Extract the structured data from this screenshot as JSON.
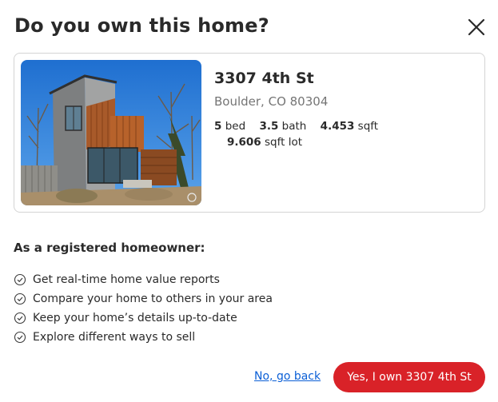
{
  "dialog": {
    "title": "Do you own this home?",
    "close_icon": "close-icon"
  },
  "property": {
    "address": "3307 4th St",
    "city_state_zip": "Boulder, CO 80304",
    "beds": "5",
    "beds_label": "bed",
    "baths": "3.5",
    "baths_label": "bath",
    "sqft": "4.453",
    "sqft_label": "sqft",
    "lot": "9.606",
    "lot_label": "sqft lot"
  },
  "benefits": {
    "heading": "As a registered homeowner:",
    "items": [
      "Get real-time home value reports",
      "Compare your home to others in your area",
      "Keep your home’s details up-to-date",
      "Explore different ways to sell"
    ]
  },
  "actions": {
    "back_label": "No, go back",
    "confirm_label": "Yes, I own 3307 4th St"
  },
  "colors": {
    "accent": "#d92228",
    "link": "#0b5fd6",
    "muted": "#757575"
  }
}
